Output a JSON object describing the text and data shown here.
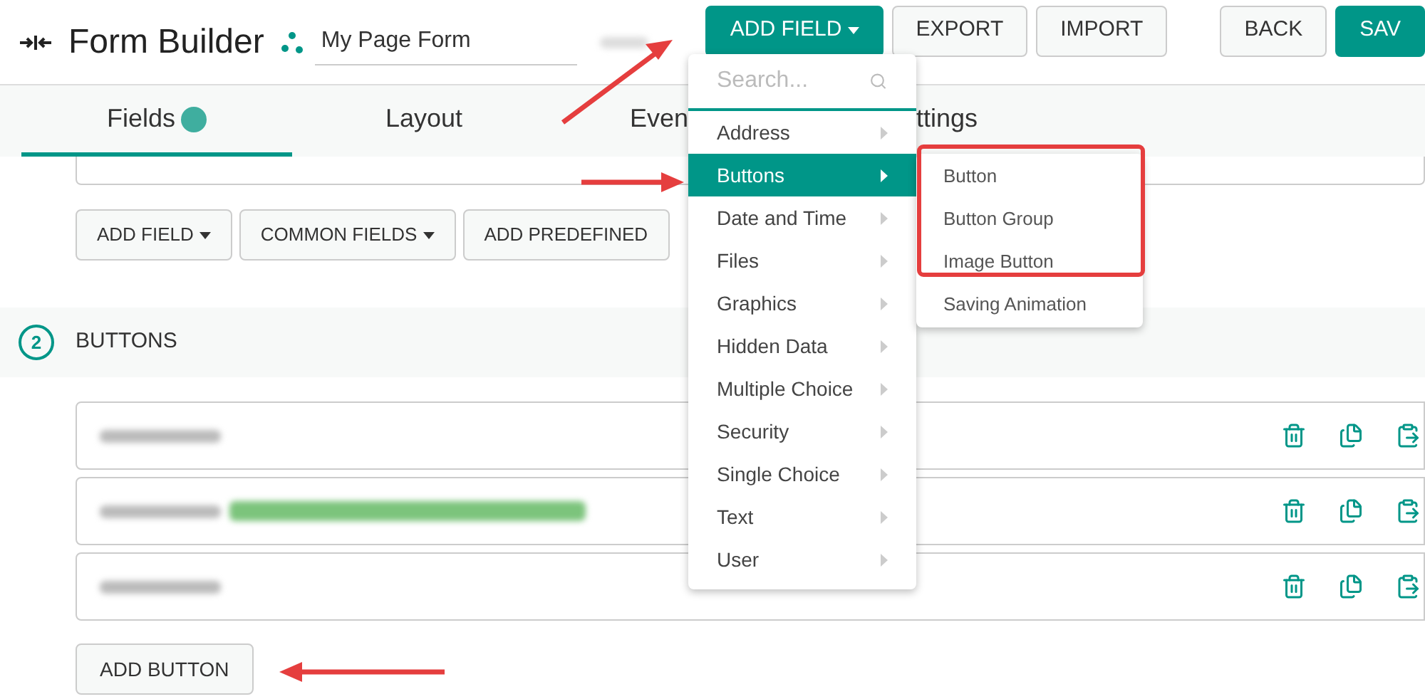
{
  "header": {
    "title": "Form Builder",
    "form_name": "My Page Form",
    "buttons": [
      {
        "label": "ADD FIELD",
        "kind": "primary",
        "caret": true
      },
      {
        "label": "EXPORT",
        "kind": "default",
        "caret": false
      },
      {
        "label": "IMPORT",
        "kind": "default",
        "caret": false
      }
    ],
    "right_buttons": [
      {
        "label": "BACK",
        "kind": "default",
        "caret": false
      },
      {
        "label": "SAV",
        "kind": "primary",
        "caret": false
      }
    ]
  },
  "tabs": [
    {
      "label": "Fields",
      "selected": true,
      "badge": true
    },
    {
      "label": "Layout",
      "selected": false,
      "badge": false
    },
    {
      "label": "Even",
      "selected": false,
      "badge": false
    },
    {
      "label": "ttings",
      "selected": false,
      "badge": false
    }
  ],
  "toolbar": [
    {
      "label": "ADD FIELD",
      "caret": true
    },
    {
      "label": "COMMON FIELDS",
      "caret": true
    },
    {
      "label": "ADD PREDEFINED",
      "caret": false
    }
  ],
  "section": {
    "number": "2",
    "title": "BUTTONS",
    "rows": [
      {
        "tagged": false
      },
      {
        "tagged": true
      },
      {
        "tagged": false
      }
    ],
    "add_button": "ADD BUTTON"
  },
  "dropdown": {
    "placeholder": "Search...",
    "items": [
      {
        "label": "Address",
        "selected": false
      },
      {
        "label": "Buttons",
        "selected": true
      },
      {
        "label": "Date and Time",
        "selected": false
      },
      {
        "label": "Files",
        "selected": false
      },
      {
        "label": "Graphics",
        "selected": false
      },
      {
        "label": "Hidden Data",
        "selected": false
      },
      {
        "label": "Multiple Choice",
        "selected": false
      },
      {
        "label": "Security",
        "selected": false
      },
      {
        "label": "Single Choice",
        "selected": false
      },
      {
        "label": "Text",
        "selected": false
      },
      {
        "label": "User",
        "selected": false
      }
    ]
  },
  "submenu": {
    "items": [
      {
        "label": "Button",
        "highlighted": true
      },
      {
        "label": "Button Group",
        "highlighted": true
      },
      {
        "label": "Image Button",
        "highlighted": true
      },
      {
        "label": "Saving Animation",
        "highlighted": false
      }
    ]
  }
}
